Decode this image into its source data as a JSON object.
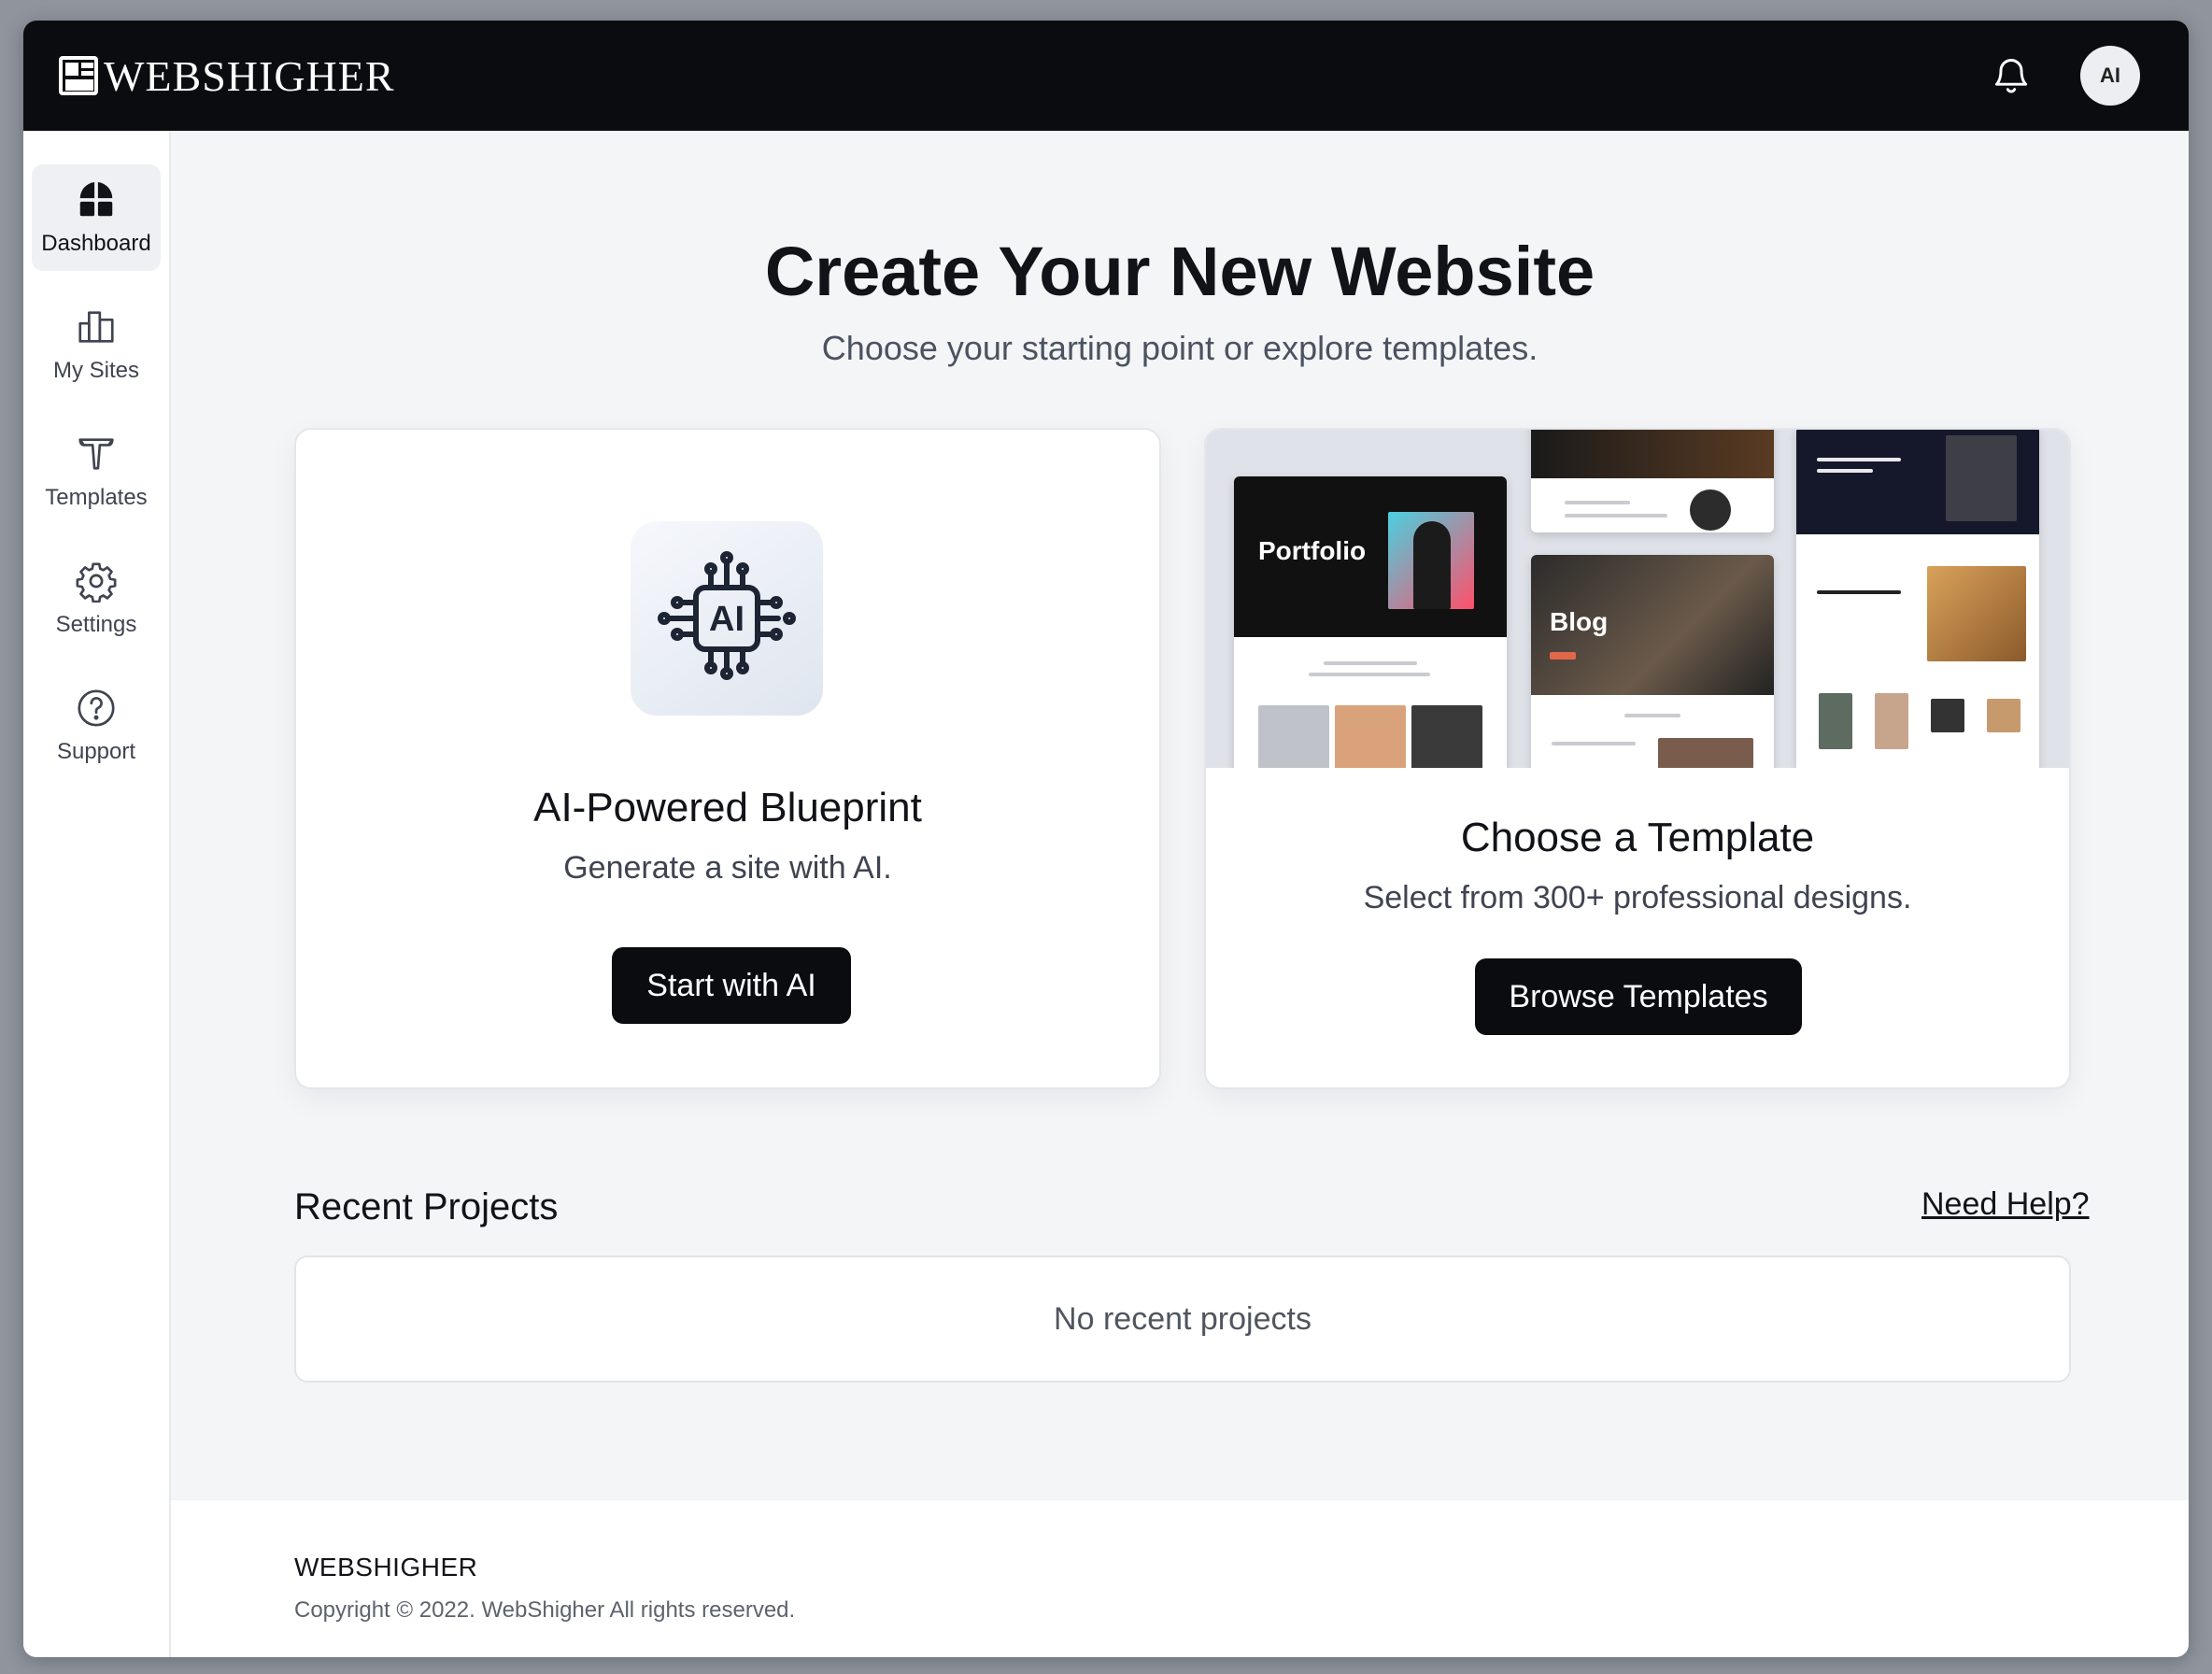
{
  "header": {
    "brand": "WEBSHIGHER",
    "avatar_initials": "AI",
    "icons": {
      "logo": "brand-logo-icon",
      "notifications": "bell-icon"
    }
  },
  "sidebar": {
    "items": [
      {
        "label": "Dashboard",
        "icon": "dashboard-icon",
        "active": true
      },
      {
        "label": "My Sites",
        "icon": "sites-icon",
        "active": false
      },
      {
        "label": "Templates",
        "icon": "templates-icon",
        "active": false
      },
      {
        "label": "Settings",
        "icon": "gear-icon",
        "active": false
      },
      {
        "label": "Support",
        "icon": "help-circle-icon",
        "active": false
      }
    ]
  },
  "hero": {
    "title": "Create Your New Website",
    "subtitle": "Choose your starting point or explore templates."
  },
  "ai_card": {
    "icon_label": "AI",
    "title": "AI-Powered Blueprint",
    "subtitle": "Generate a site with AI.",
    "button": "Start with AI"
  },
  "template_card": {
    "preview": {
      "portfolio": "Portfolio",
      "blog": "Blog"
    },
    "title": "Choose a Template",
    "subtitle": "Select from 300+ professional designs.",
    "button": "Browse Templates"
  },
  "recent": {
    "title": "Recent Projects",
    "help_link": "Need Help?",
    "empty_text": "No recent projects"
  },
  "footer": {
    "brand": "WEBSHIGHER",
    "copyright": "Copyright © 2022. WebShigher All rights reserved."
  },
  "colors": {
    "topbar": "#0b0c10",
    "page_bg": "#f4f5f7",
    "button": "#0b0c10",
    "accent_text": "#111318"
  }
}
